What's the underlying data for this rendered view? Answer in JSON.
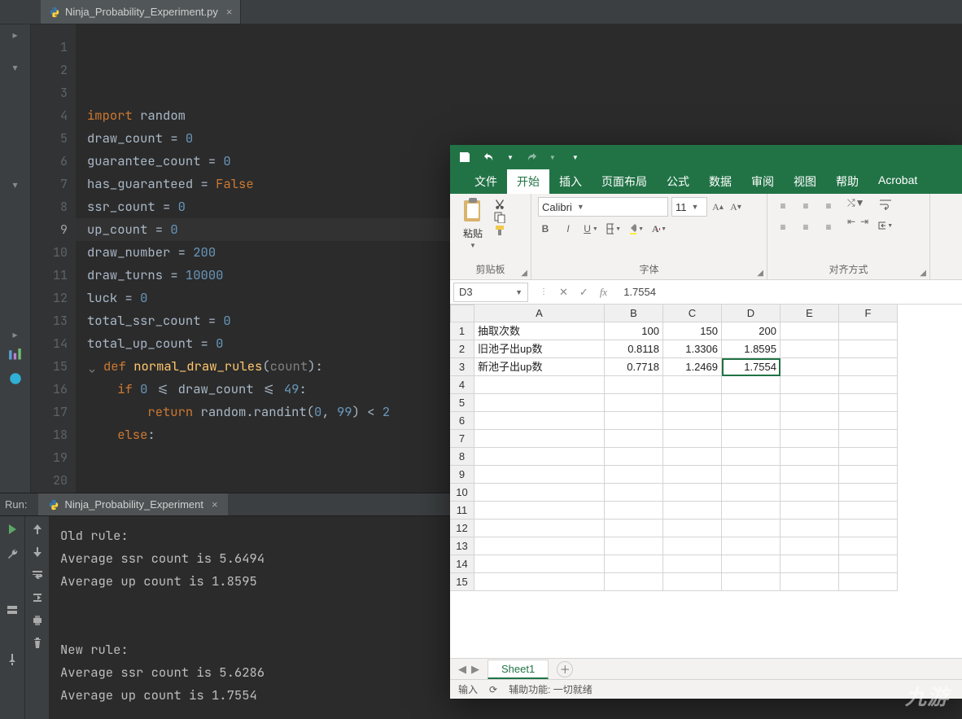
{
  "ide": {
    "tab_filename": "Ninja_Probability_Experiment.py",
    "tab_close": "×",
    "lines": [
      "1",
      "2",
      "3",
      "4",
      "5",
      "6",
      "7",
      "8",
      "9",
      "10",
      "11",
      "12",
      "13",
      "14",
      "15",
      "16",
      "17",
      "18",
      "19",
      "20"
    ],
    "highlight_line": 9,
    "code_tokens": [
      [
        [
          "import",
          "kw"
        ],
        [
          " random",
          "plain"
        ]
      ],
      [
        [
          "",
          "plain"
        ]
      ],
      [
        [
          "draw_count ",
          "plain"
        ],
        [
          "= ",
          "plain"
        ],
        [
          "0",
          "num"
        ]
      ],
      [
        [
          "guarantee_count ",
          "plain"
        ],
        [
          "= ",
          "plain"
        ],
        [
          "0",
          "num"
        ]
      ],
      [
        [
          "has_guaranteed ",
          "plain"
        ],
        [
          "= ",
          "plain"
        ],
        [
          "False",
          "kw"
        ]
      ],
      [
        [
          "ssr_count ",
          "plain"
        ],
        [
          "= ",
          "plain"
        ],
        [
          "0",
          "num"
        ]
      ],
      [
        [
          "up_count ",
          "plain"
        ],
        [
          "= ",
          "plain"
        ],
        [
          "0",
          "num"
        ]
      ],
      [
        [
          "",
          "plain"
        ]
      ],
      [
        [
          "draw_number ",
          "plain"
        ],
        [
          "= ",
          "plain"
        ],
        [
          "200",
          "num"
        ]
      ],
      [
        [
          "draw_turns ",
          "plain"
        ],
        [
          "= ",
          "plain"
        ],
        [
          "10000",
          "num"
        ]
      ],
      [
        [
          "",
          "plain"
        ]
      ],
      [
        [
          "luck ",
          "plain"
        ],
        [
          "= ",
          "plain"
        ],
        [
          "0",
          "num"
        ]
      ],
      [
        [
          "",
          "plain"
        ]
      ],
      [
        [
          "total_ssr_count ",
          "plain"
        ],
        [
          "= ",
          "plain"
        ],
        [
          "0",
          "num"
        ]
      ],
      [
        [
          "total_up_count ",
          "plain"
        ],
        [
          "= ",
          "plain"
        ],
        [
          "0",
          "num"
        ]
      ],
      [
        [
          "",
          "plain"
        ]
      ],
      [
        [
          "def ",
          "kw"
        ],
        [
          "normal_draw_rules",
          "fn"
        ],
        [
          "(",
          "plain"
        ],
        [
          "count",
          "par"
        ],
        [
          "):",
          "plain"
        ]
      ],
      [
        [
          "    if ",
          "kw"
        ],
        [
          "0",
          "num"
        ],
        [
          " <= draw_count <= ",
          "plain"
        ],
        [
          "49",
          "num"
        ],
        [
          ":",
          "plain"
        ]
      ],
      [
        [
          "        return ",
          "kw"
        ],
        [
          "random.randint(",
          "plain"
        ],
        [
          "0",
          "num"
        ],
        [
          ", ",
          "plain"
        ],
        [
          "99",
          "num"
        ],
        [
          ") < ",
          "plain"
        ],
        [
          "2",
          "num"
        ]
      ],
      [
        [
          "    else",
          "kw"
        ],
        [
          ":",
          "plain"
        ]
      ]
    ]
  },
  "run": {
    "label": "Run:",
    "tab": "Ninja_Probability_Experiment",
    "tab_close": "×",
    "output": "Old rule:\nAverage ssr count is 5.6494\nAverage up count is 1.8595\n\n\nNew rule:\nAverage ssr count is 5.6286\nAverage up count is 1.7554"
  },
  "excel": {
    "ribbon_tabs": [
      "文件",
      "开始",
      "插入",
      "页面布局",
      "公式",
      "数据",
      "审阅",
      "视图",
      "帮助",
      "Acrobat"
    ],
    "ribbon_active_index": 1,
    "group_paste": "剪贴板",
    "paste_label": "粘贴",
    "group_font": "字体",
    "group_align": "对齐方式",
    "font_name": "Calibri",
    "font_size": "11",
    "namebox": "D3",
    "formula_value": "1.7554",
    "colheads": [
      "A",
      "B",
      "C",
      "D",
      "E",
      "F"
    ],
    "rows": [
      {
        "h": "1",
        "c": [
          "抽取次数",
          "100",
          "150",
          "200",
          "",
          ""
        ]
      },
      {
        "h": "2",
        "c": [
          "旧池子出up数",
          "0.8118",
          "1.3306",
          "1.8595",
          "",
          ""
        ]
      },
      {
        "h": "3",
        "c": [
          "新池子出up数",
          "0.7718",
          "1.2469",
          "1.7554",
          "",
          ""
        ]
      },
      {
        "h": "4",
        "c": [
          "",
          "",
          "",
          "",
          "",
          ""
        ]
      },
      {
        "h": "5",
        "c": [
          "",
          "",
          "",
          "",
          "",
          ""
        ]
      },
      {
        "h": "6",
        "c": [
          "",
          "",
          "",
          "",
          "",
          ""
        ]
      },
      {
        "h": "7",
        "c": [
          "",
          "",
          "",
          "",
          "",
          ""
        ]
      },
      {
        "h": "8",
        "c": [
          "",
          "",
          "",
          "",
          "",
          ""
        ]
      },
      {
        "h": "9",
        "c": [
          "",
          "",
          "",
          "",
          "",
          ""
        ]
      },
      {
        "h": "10",
        "c": [
          "",
          "",
          "",
          "",
          "",
          ""
        ]
      },
      {
        "h": "11",
        "c": [
          "",
          "",
          "",
          "",
          "",
          ""
        ]
      },
      {
        "h": "12",
        "c": [
          "",
          "",
          "",
          "",
          "",
          ""
        ]
      },
      {
        "h": "13",
        "c": [
          "",
          "",
          "",
          "",
          "",
          ""
        ]
      },
      {
        "h": "14",
        "c": [
          "",
          "",
          "",
          "",
          "",
          ""
        ]
      },
      {
        "h": "15",
        "c": [
          "",
          "",
          "",
          "",
          "",
          ""
        ]
      }
    ],
    "selected": {
      "row": 3,
      "col": 4
    },
    "sheet_tab": "Sheet1",
    "status_mode": "输入",
    "status_a11y": "辅助功能: 一切就绪"
  },
  "chart_data": {
    "type": "table",
    "title": "",
    "columns": [
      "抽取次数",
      "100",
      "150",
      "200"
    ],
    "series": [
      {
        "name": "旧池子出up数",
        "values": [
          0.8118,
          1.3306,
          1.8595
        ]
      },
      {
        "name": "新池子出up数",
        "values": [
          0.7718,
          1.2469,
          1.7554
        ]
      }
    ]
  },
  "watermark": "九游"
}
